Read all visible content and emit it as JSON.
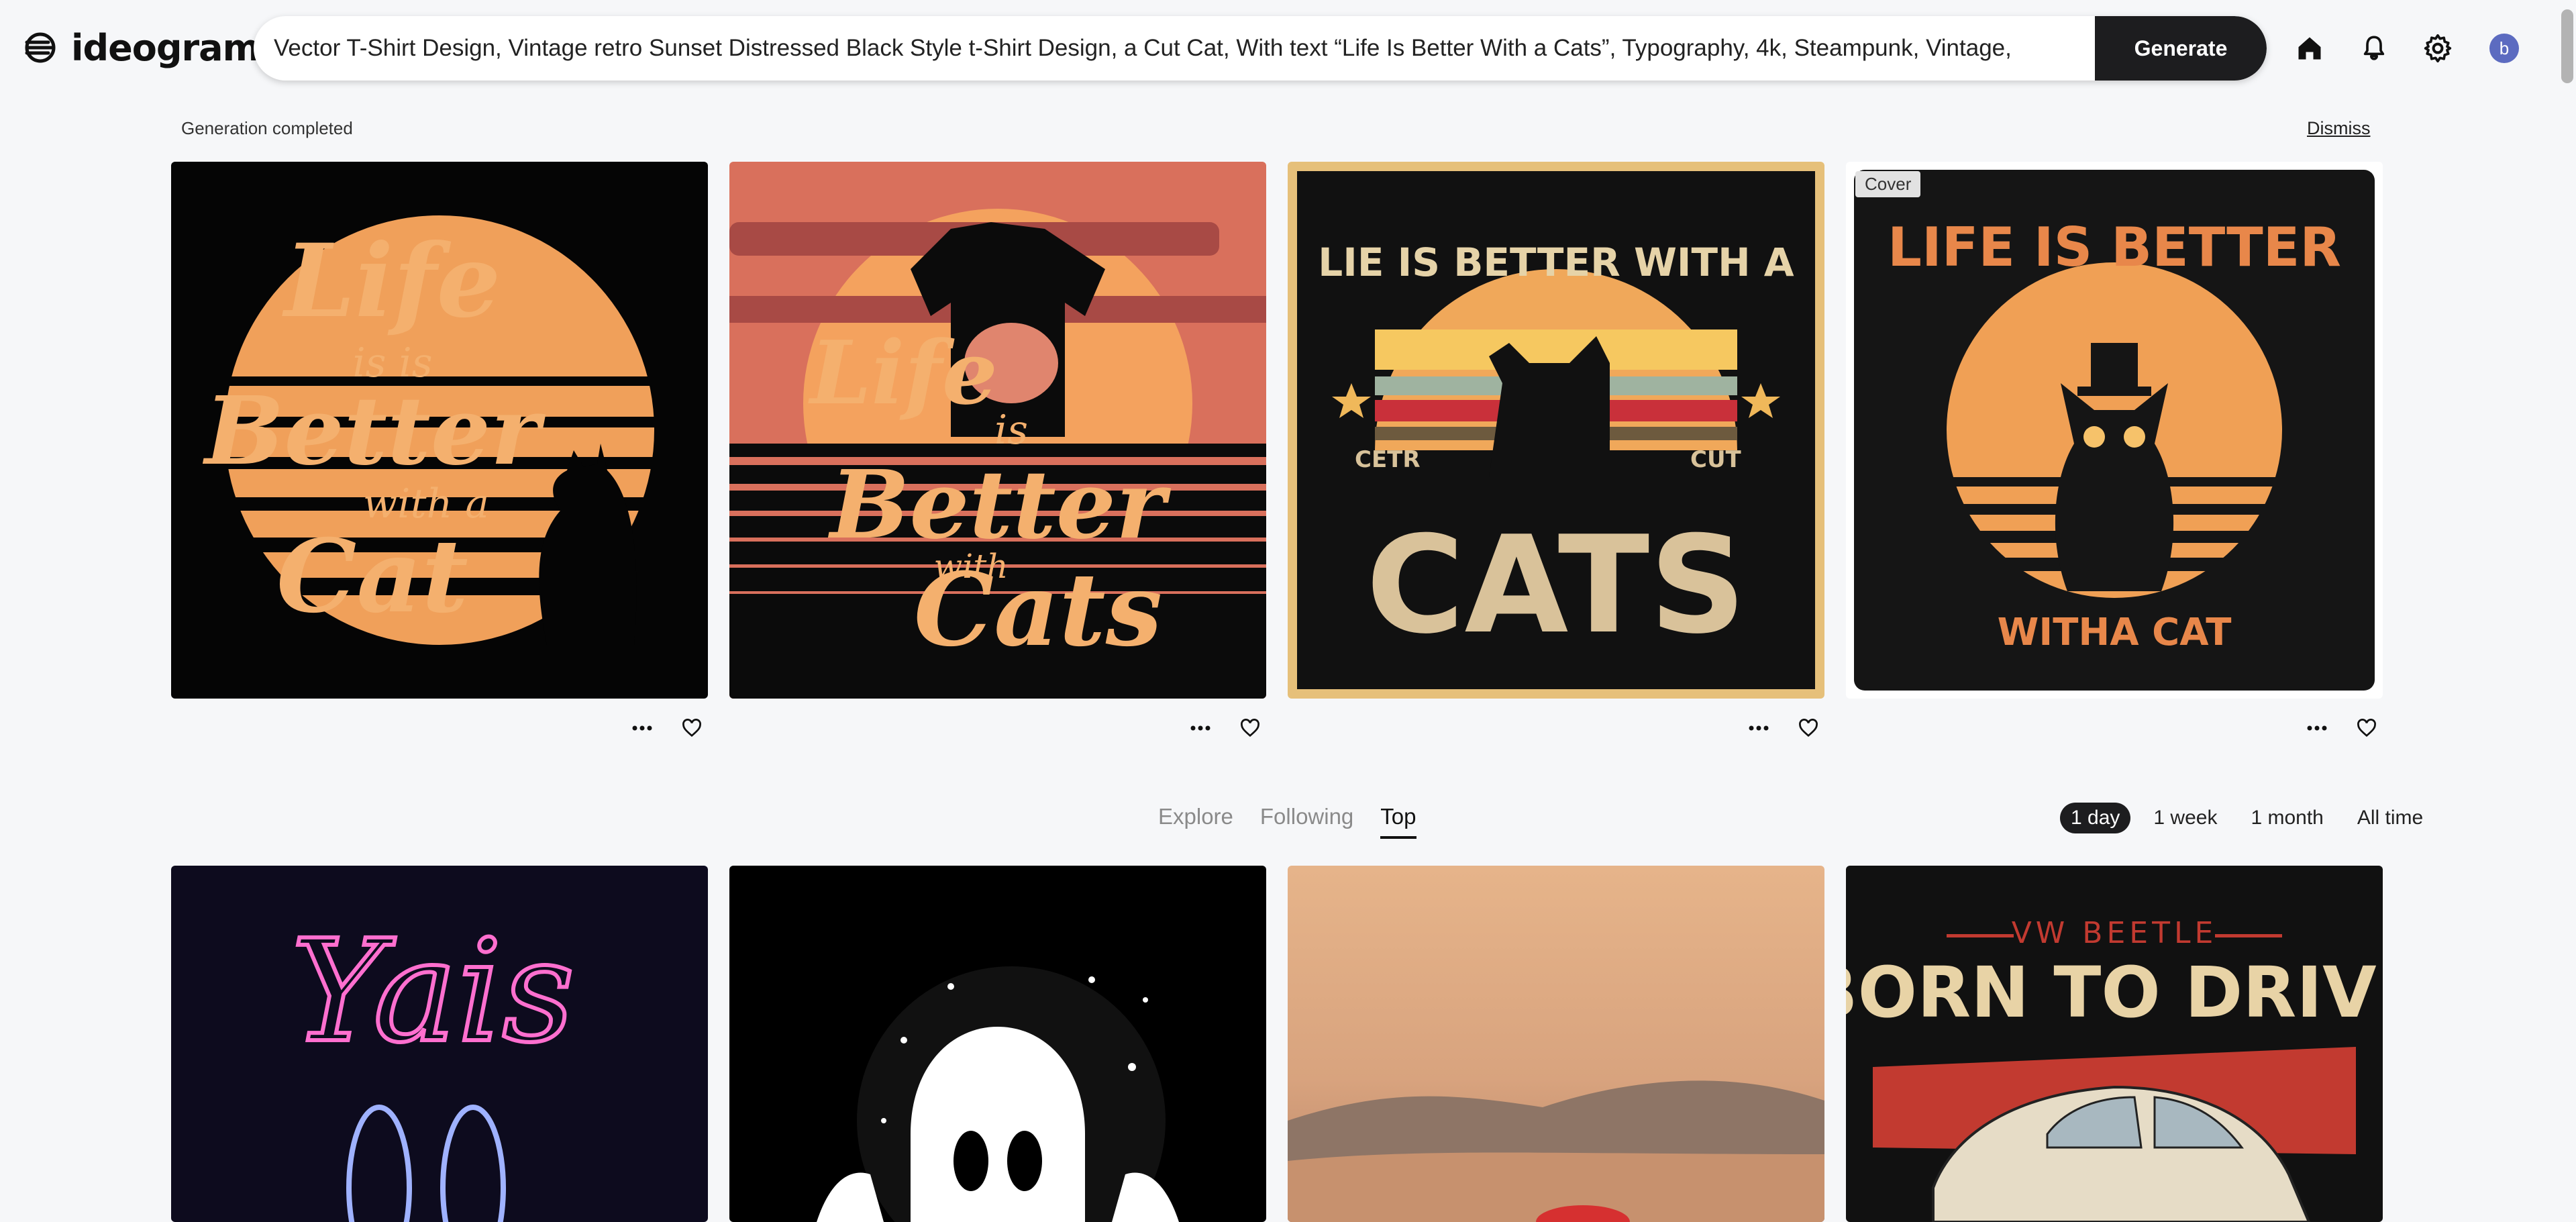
{
  "app": {
    "name": "ideogram"
  },
  "search": {
    "prompt": "Vector T-Shirt Design, Vintage retro Sunset Distressed Black Style t-Shirt Design, a Cut Cat, With text “Life Is Better With a Cats”, Typography, 4k, Steampunk, Vintage,"
  },
  "header": {
    "generate_label": "Generate",
    "avatar_initial": "b"
  },
  "status": {
    "text": "Generation completed",
    "dismiss_label": "Dismiss"
  },
  "generations": [
    {
      "text_lines": [
        "Life",
        "is is",
        "Better",
        "with a",
        "Cat"
      ]
    },
    {
      "text_lines": [
        "Life",
        "is",
        "Better",
        "with",
        "Cats"
      ]
    },
    {
      "text_lines": [
        "LIE IS BETTER WITH A",
        "CETR",
        "CUT",
        "CATS"
      ]
    },
    {
      "text_lines": [
        "LIFE IS BETTER",
        "WITHA CAT"
      ],
      "badge": "Cover"
    }
  ],
  "feed_tabs": [
    "Explore",
    "Following",
    "Top"
  ],
  "active_tab": "Top",
  "time_ranges": [
    "1 day",
    "1 week",
    "1 month",
    "All time"
  ],
  "active_range": "1 day",
  "feed": [
    {
      "text_lines": [
        "Yais"
      ]
    },
    {
      "text_lines": []
    },
    {
      "text_lines": []
    },
    {
      "text_lines": [
        "VW BEETLE",
        "BORN TO DRIVE"
      ]
    }
  ],
  "colors": {
    "accent_dark": "#1d1d1f",
    "sunset_orange": "#f0a05a",
    "avatar": "#5c6bc0",
    "neon_pink": "#ff6fcf"
  }
}
